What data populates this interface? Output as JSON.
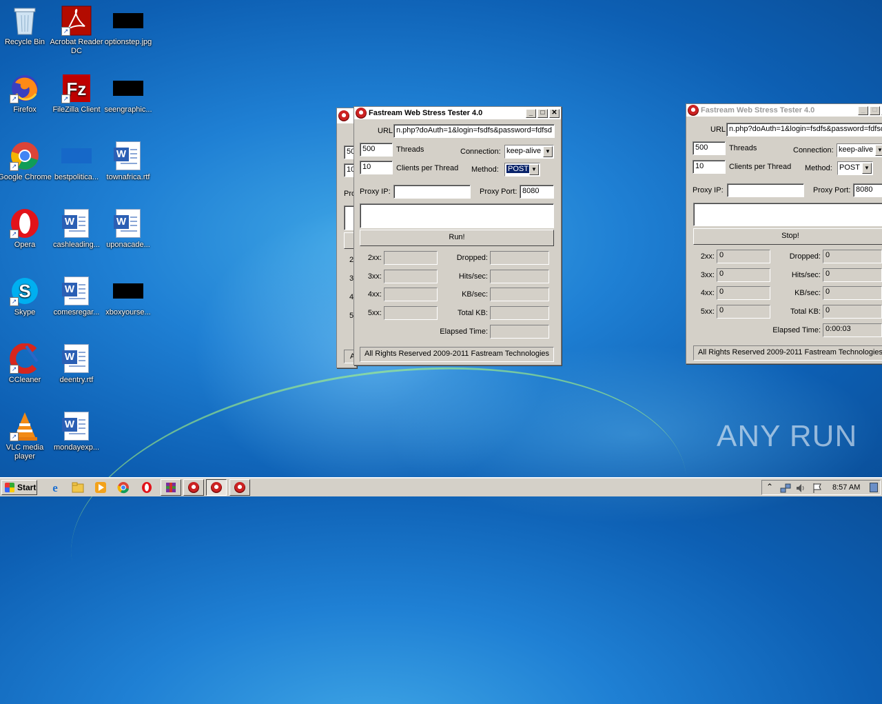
{
  "desktop": {
    "icons": [
      {
        "label": "Recycle Bin",
        "icon": "recycle-bin-icon"
      },
      {
        "label": "Acrobat Reader DC",
        "icon": "acrobat-icon"
      },
      {
        "label": "optionstep.jpg",
        "icon": "image-file-icon"
      },
      {
        "label": "Firefox",
        "icon": "firefox-icon"
      },
      {
        "label": "FileZilla Client",
        "icon": "filezilla-icon"
      },
      {
        "label": "seengraphic...",
        "icon": "image-file-icon"
      },
      {
        "label": "Google Chrome",
        "icon": "chrome-icon"
      },
      {
        "label": "bestpolitica...",
        "icon": "file-icon"
      },
      {
        "label": "townafrica.rtf",
        "icon": "word-doc-icon"
      },
      {
        "label": "Opera",
        "icon": "opera-icon"
      },
      {
        "label": "cashleading...",
        "icon": "word-doc-icon"
      },
      {
        "label": "uponacade...",
        "icon": "word-doc-icon"
      },
      {
        "label": "Skype",
        "icon": "skype-icon"
      },
      {
        "label": "comesregar...",
        "icon": "word-doc-icon"
      },
      {
        "label": "xboxyourse...",
        "icon": "image-file-icon"
      },
      {
        "label": "CCleaner",
        "icon": "ccleaner-icon"
      },
      {
        "label": "deentry.rtf",
        "icon": "word-doc-icon"
      },
      {
        "label": "VLC media player",
        "icon": "vlc-icon"
      },
      {
        "label": "mondayexp...",
        "icon": "word-doc-icon"
      }
    ],
    "watermark": "ANY RUN"
  },
  "app_common": {
    "url_label": "URL",
    "threads_label": "Threads",
    "clients_label": "Clients per Thread",
    "connection_label": "Connection:",
    "method_label": "Method:",
    "proxy_ip_label": "Proxy IP:",
    "proxy_port_label": "Proxy Port:",
    "label_2xx": "2xx:",
    "label_3xx": "3xx:",
    "label_4xx": "4xx:",
    "label_5xx": "5xx:",
    "dropped_label": "Dropped:",
    "hits_label": "Hits/sec:",
    "kbs_label": "KB/sec:",
    "totalkb_label": "Total KB:",
    "elapsed_label": "Elapsed Time:",
    "copyright": "All Rights Reserved 2009-2011 Fastream Technologies"
  },
  "window_main": {
    "title": "Fastream Web Stress Tester 4.0",
    "url": "n.php?doAuth=1&login=fsdfs&password=fdfsd",
    "threads": "500",
    "clients": "10",
    "connection": "keep-alive",
    "method": "POST",
    "proxy_ip": "",
    "proxy_port": "8080",
    "run_button": "Run!",
    "stats": {
      "s2xx": "",
      "s3xx": "",
      "s4xx": "",
      "s5xx": "",
      "dropped": "",
      "hits": "",
      "kbs": "",
      "totalkb": "",
      "elapsed": ""
    }
  },
  "window_right": {
    "title": "Fastream Web Stress Tester 4.0",
    "url": "n.php?doAuth=1&login=fsdfs&password=fdfsd",
    "threads": "500",
    "clients": "10",
    "connection": "keep-alive",
    "method": "POST",
    "proxy_port": "8080",
    "stop_button": "Stop!",
    "stats": {
      "s2xx": "0",
      "s3xx": "0",
      "s4xx": "0",
      "s5xx": "0",
      "dropped": "0",
      "hits": "0",
      "kbs": "0",
      "totalkb": "0",
      "elapsed": "0:00:03"
    }
  },
  "window_back": {
    "partial_labels": {
      "v500": "50",
      "v10": "10",
      "pro": "Pro",
      "r2": "2",
      "r3": "3",
      "r4": "4",
      "r5": "5",
      "a": "A"
    }
  },
  "taskbar": {
    "start_label": "Start",
    "clock": "8:57 AM",
    "tray_expand": "⌃"
  }
}
